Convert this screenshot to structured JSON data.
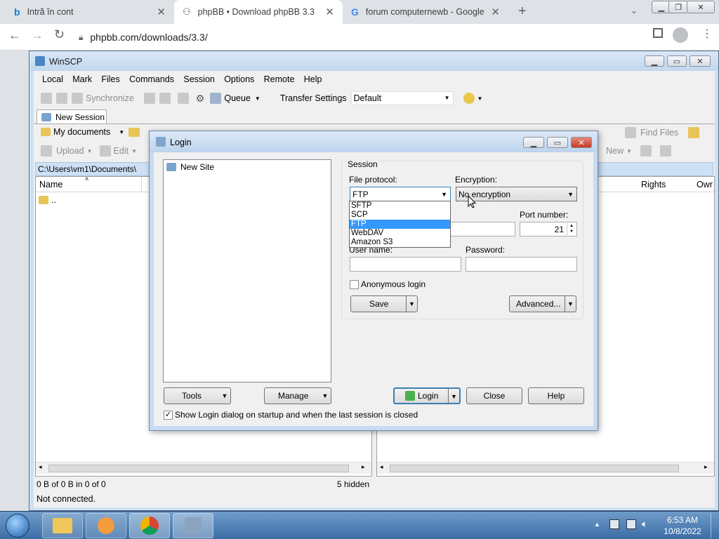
{
  "browser": {
    "tabs": [
      {
        "title": "Intră în cont"
      },
      {
        "title": "phpBB • Download phpBB 3.3"
      },
      {
        "title": "forum computernewb - Google S"
      }
    ],
    "url": "phpbb.com/downloads/3.3/"
  },
  "winscp": {
    "title": "WinSCP",
    "menu": [
      "Local",
      "Mark",
      "Files",
      "Commands",
      "Session",
      "Options",
      "Remote",
      "Help"
    ],
    "toolbar": {
      "synchronize": "Synchronize",
      "queue": "Queue",
      "transfer_settings_label": "Transfer Settings",
      "transfer_settings_value": "Default"
    },
    "session_tab": "New Session",
    "local": {
      "location": "My documents",
      "upload": "Upload",
      "edit": "Edit",
      "path": "C:\\Users\\vm1\\Documents\\",
      "col_name": "Name",
      "parent_row": "..",
      "status": "0 B of 0 B in 0 of 0",
      "hidden": "5 hidden"
    },
    "remote": {
      "find_files": "Find Files",
      "new": "New",
      "col_rights": "Rights",
      "col_owner": "Owr"
    },
    "status_bar": "Not connected."
  },
  "login": {
    "title": "Login",
    "site_tree": [
      "New Site"
    ],
    "session_group": "Session",
    "file_protocol_label": "File protocol:",
    "file_protocol_value": "FTP",
    "protocol_options": [
      "SFTP",
      "SCP",
      "FTP",
      "WebDAV",
      "Amazon S3"
    ],
    "protocol_selected": "FTP",
    "encryption_label": "Encryption:",
    "encryption_value": "No encryption",
    "port_label": "Port number:",
    "port_value": "21",
    "user_label": "User name:",
    "password_label": "Password:",
    "anonymous_label": "Anonymous login",
    "save": "Save",
    "advanced": "Advanced...",
    "tools": "Tools",
    "manage": "Manage",
    "login_btn": "Login",
    "close": "Close",
    "help": "Help",
    "show_login": "Show Login dialog on startup and when the last session is closed"
  },
  "taskbar": {
    "time": "6:53 AM",
    "date": "10/8/2022"
  }
}
